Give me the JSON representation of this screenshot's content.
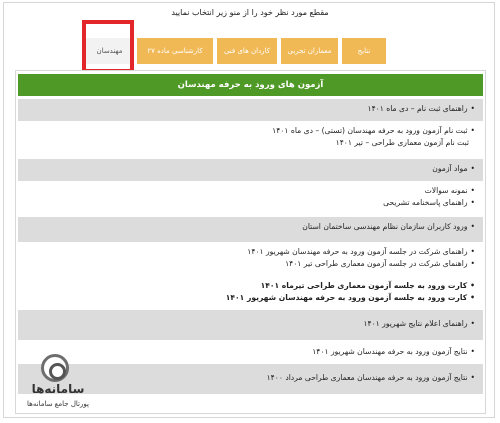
{
  "instruction": "مقطع مورد نظر خود را از منو زیر انتخاب نمایید",
  "tabs": [
    {
      "label": "مهندسان",
      "active": true
    },
    {
      "label": "کارشناسی ماده ۲۷",
      "active": false
    },
    {
      "label": "کاردان های فنی",
      "active": false
    },
    {
      "label": "معماران تجربی",
      "active": false
    },
    {
      "label": "نتایج",
      "active": false
    }
  ],
  "content": {
    "title": "آزمون های ورود به حرفه مهندسان",
    "sections": [
      {
        "items": [
          "راهنمای ثبت نام – دی ماه ۱۴۰۱"
        ]
      },
      {
        "items": [
          "ثبت نام آزمون ورود به حرفه مهندسان (تستی) – دی ماه ۱۴۰۱",
          "ثبت نام آزمون معماری طراحی – تیر ۱۴۰۱"
        ]
      },
      {
        "items": [
          "مواد آزمون"
        ]
      },
      {
        "items": [
          "نمونه سوالات",
          "راهنمای پاسخنامه تشریحی"
        ]
      },
      {
        "items": [
          "ورود کاربران سازمان نظام مهندسی ساختمان استان"
        ]
      },
      {
        "items": [
          "راهنمای شرکت در جلسه آزمون ورود به حرفه مهندسان شهریور ۱۴۰۱",
          "راهنمای شرکت در جلسه آزمون معماری طراحی تیر ۱۴۰۱"
        ]
      },
      {
        "items": [
          "کارت ورود به جلسه آزمون معماری طراحی تیرماه ۱۴۰۱",
          "کارت ورود به جلسه آزمون ورود به حرفه مهندسان شهریور ۱۴۰۱"
        ]
      },
      {
        "items": [
          "راهنمای اعلام نتایج شهریور ۱۴۰۱"
        ]
      },
      {
        "items": [
          "نتایج آزمون ورود به حرفه مهندسان شهریور ۱۴۰۱"
        ]
      },
      {
        "items": [
          "نتایج آزمون ورود به حرفه مهندسان معماری طراحی مرداد ۱۴۰۰"
        ]
      }
    ]
  },
  "logo": {
    "title": "سامانه‌ها",
    "subtitle": "پورتال جامع سامانه‌ها"
  },
  "colors": {
    "tab": "#f0b956",
    "header": "#4f9a26",
    "highlight": "#e2262a",
    "grey_row": "#dcdcdc"
  }
}
